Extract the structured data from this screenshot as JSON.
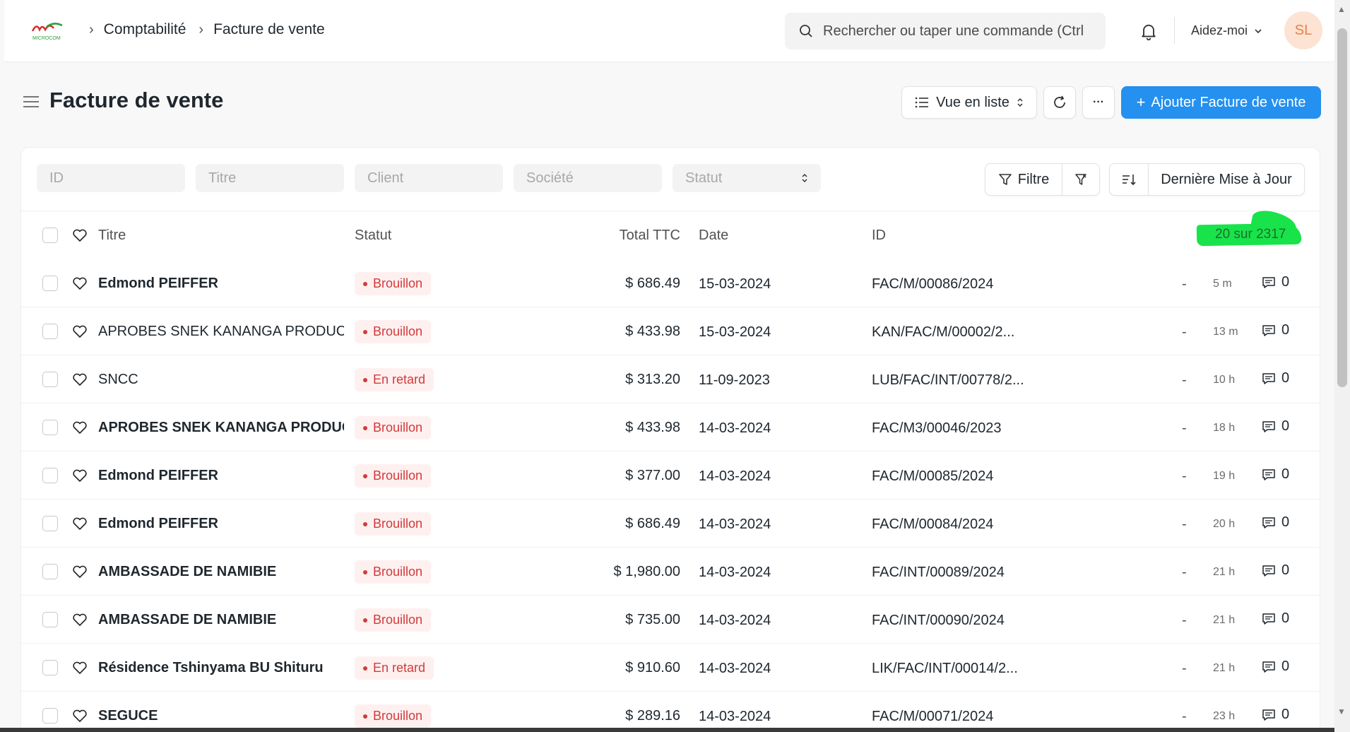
{
  "nav": {
    "logo_text": "MICROCOM",
    "breadcrumbs": [
      "Comptabilité",
      "Facture de vente"
    ],
    "search_placeholder": "Rechercher ou taper une commande (Ctrl",
    "help_label": "Aidez-moi",
    "avatar_initials": "SL"
  },
  "page": {
    "title": "Facture de vente",
    "view_label": "Vue en liste",
    "add_label": "Ajouter Facture de vente",
    "more_label": "···"
  },
  "filters": {
    "id_placeholder": "ID",
    "title_placeholder": "Titre",
    "client_placeholder": "Client",
    "company_placeholder": "Société",
    "status_placeholder": "Statut",
    "filter_label": "Filtre",
    "sort_label": "Dernière Mise à Jour"
  },
  "table": {
    "headers": {
      "title": "Titre",
      "status": "Statut",
      "total": "Total TTC",
      "date": "Date",
      "id": "ID"
    },
    "count": "20 sur 2317",
    "rows": [
      {
        "title": "Edmond PEIFFER",
        "bold": true,
        "status": "Brouillon",
        "amount": "$ 686.49",
        "date": "15-03-2024",
        "id": "FAC/M/00086/2024",
        "dash": "-",
        "age": "5 m",
        "comments": "0"
      },
      {
        "title": "APROBES SNEK KANANGA PRODUCT",
        "bold": false,
        "status": "Brouillon",
        "amount": "$ 433.98",
        "date": "15-03-2024",
        "id": "KAN/FAC/M/00002/2...",
        "dash": "-",
        "age": "13 m",
        "comments": "0"
      },
      {
        "title": "SNCC",
        "bold": false,
        "status": "En retard",
        "amount": "$ 313.20",
        "date": "11-09-2023",
        "id": "LUB/FAC/INT/00778/2...",
        "dash": "-",
        "age": "10 h",
        "comments": "0"
      },
      {
        "title": "APROBES SNEK KANANGA PRODUC",
        "bold": true,
        "status": "Brouillon",
        "amount": "$ 433.98",
        "date": "14-03-2024",
        "id": "FAC/M3/00046/2023",
        "dash": "-",
        "age": "18 h",
        "comments": "0"
      },
      {
        "title": "Edmond PEIFFER",
        "bold": true,
        "status": "Brouillon",
        "amount": "$ 377.00",
        "date": "14-03-2024",
        "id": "FAC/M/00085/2024",
        "dash": "-",
        "age": "19 h",
        "comments": "0"
      },
      {
        "title": "Edmond PEIFFER",
        "bold": true,
        "status": "Brouillon",
        "amount": "$ 686.49",
        "date": "14-03-2024",
        "id": "FAC/M/00084/2024",
        "dash": "-",
        "age": "20 h",
        "comments": "0"
      },
      {
        "title": "AMBASSADE DE NAMIBIE",
        "bold": true,
        "status": "Brouillon",
        "amount": "$ 1,980.00",
        "date": "14-03-2024",
        "id": "FAC/INT/00089/2024",
        "dash": "-",
        "age": "21 h",
        "comments": "0"
      },
      {
        "title": "AMBASSADE DE NAMIBIE",
        "bold": true,
        "status": "Brouillon",
        "amount": "$ 735.00",
        "date": "14-03-2024",
        "id": "FAC/INT/00090/2024",
        "dash": "-",
        "age": "21 h",
        "comments": "0"
      },
      {
        "title": "Résidence Tshinyama BU Shituru",
        "bold": true,
        "status": "En retard",
        "amount": "$ 910.60",
        "date": "14-03-2024",
        "id": "LIK/FAC/INT/00014/2...",
        "dash": "-",
        "age": "21 h",
        "comments": "0"
      },
      {
        "title": "SEGUCE",
        "bold": true,
        "status": "Brouillon",
        "amount": "$ 289.16",
        "date": "14-03-2024",
        "id": "FAC/M/00071/2024",
        "dash": "-",
        "age": "23 h",
        "comments": "0"
      }
    ]
  },
  "colors": {
    "primary": "#2490ef",
    "status_red": "#d33a3a",
    "status_red_bg": "#fff0f0",
    "highlight_green": "#19e34a",
    "avatar_bg": "#fde3d3",
    "avatar_fg": "#e8804a"
  },
  "icons": [
    "microcom-logo",
    "chevron-right-icon",
    "search-icon",
    "bell-icon",
    "chevron-down-icon",
    "hamburger-icon",
    "list-icon",
    "sort-updown-icon",
    "refresh-icon",
    "ellipsis-icon",
    "plus-icon",
    "filter-icon",
    "filter-clear-icon",
    "sort-direction-icon",
    "heart-icon",
    "comment-icon"
  ]
}
